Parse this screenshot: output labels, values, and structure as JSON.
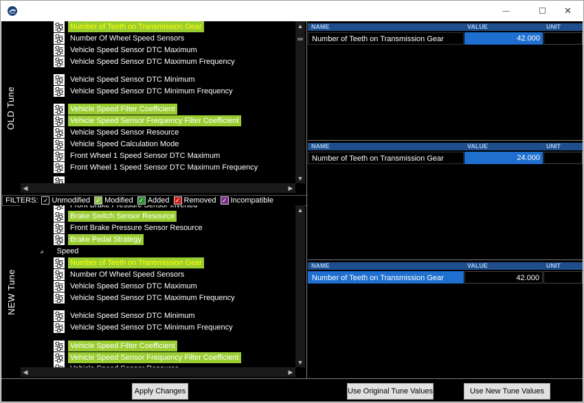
{
  "window": {
    "controls": {
      "minimize": "—",
      "maximize": "☐",
      "close": "✕"
    }
  },
  "panels": {
    "old_label": "OLD Tune",
    "new_label": "NEW Tune"
  },
  "old_tree": [
    {
      "label": "Number of Teeth on Transmission Gear",
      "style": "selected"
    },
    {
      "label": "Number Of Wheel Speed Sensors",
      "style": "plain"
    },
    {
      "label": "Vehicle Speed Sensor DTC Maximum",
      "style": "plain"
    },
    {
      "label": "Vehicle Speed Sensor DTC Maximum Frequency",
      "style": "plain"
    },
    {
      "label": "Vehicle Speed Sensor DTC Minimum",
      "style": "plain"
    },
    {
      "label": "Vehicle Speed Sensor DTC Minimum Frequency",
      "style": "plain"
    },
    {
      "label": "Vehicle Speed Filter Coefficient",
      "style": "modified"
    },
    {
      "label": "Vehicle Speed Sensor Frequency Filter Coefficient",
      "style": "modified"
    },
    {
      "label": "Vehicle Speed Sensor Resource",
      "style": "plain"
    },
    {
      "label": "Vehicle Speed Calculation Mode",
      "style": "plain"
    },
    {
      "label": "Front Wheel 1 Speed Sensor DTC Maximum",
      "style": "plain"
    },
    {
      "label": "Front Wheel 1 Speed Sensor DTC Maximum Frequency",
      "style": "plain"
    }
  ],
  "filters": {
    "label": "FILTERS:",
    "items": [
      {
        "label": "Unmodified",
        "color": "#000000",
        "checked": true
      },
      {
        "label": "Modified",
        "color": "#8bc34a",
        "checked": true
      },
      {
        "label": "Added",
        "color": "#2e8b2e",
        "checked": true
      },
      {
        "label": "Removed",
        "color": "#cc2222",
        "checked": true
      },
      {
        "label": "Incompatible",
        "color": "#7b2d8e",
        "checked": true
      }
    ]
  },
  "new_tree": {
    "partial_top": "Front Brake Pressure Sensor Inverted",
    "items_before_group": [
      {
        "label": "Brake Switch Sensor Resource",
        "style": "modified"
      },
      {
        "label": "Front Brake Pressure Sensor Resource",
        "style": "plain"
      },
      {
        "label": "Brake Pedal Strategy",
        "style": "modified"
      }
    ],
    "group_label": "Speed",
    "group_arrow": "◢",
    "items_after_group": [
      {
        "label": "Number of Teeth on Transmission Gear",
        "style": "selected"
      },
      {
        "label": "Number Of Wheel Speed Sensors",
        "style": "plain"
      },
      {
        "label": "Vehicle Speed Sensor DTC Maximum",
        "style": "plain"
      },
      {
        "label": "Vehicle Speed Sensor DTC Maximum Frequency",
        "style": "plain"
      },
      {
        "label": "Vehicle Speed Sensor DTC Minimum",
        "style": "plain"
      },
      {
        "label": "Vehicle Speed Sensor DTC Minimum Frequency",
        "style": "plain"
      },
      {
        "label": "Vehicle Speed Filter Coefficient",
        "style": "modified"
      },
      {
        "label": "Vehicle Speed Sensor Frequency Filter Coefficient",
        "style": "modified"
      }
    ],
    "partial_bottom": "Vehicle Speed Sensor Resource"
  },
  "grids": {
    "headers": {
      "name": "NAME",
      "value": "VALUE",
      "unit": "UNIT"
    },
    "old": {
      "name": "Number of Teeth on Transmission Gear",
      "value": "42.000",
      "unit": ""
    },
    "new": {
      "name": "Number of Teeth on Transmission Gear",
      "value": "24.000",
      "unit": ""
    },
    "result": {
      "name": "Number of Teeth on Transmission Gear",
      "value": "42.000",
      "unit": ""
    }
  },
  "buttons": {
    "apply": "Apply Changes",
    "use_original": "Use Original Tune Values",
    "use_new": "Use New Tune Values"
  },
  "colors": {
    "modified_highlight": "#9acd32",
    "selected_text": "#ffff00",
    "header_blue": "#1e4f8c",
    "value_blue": "#1e6fd0"
  }
}
